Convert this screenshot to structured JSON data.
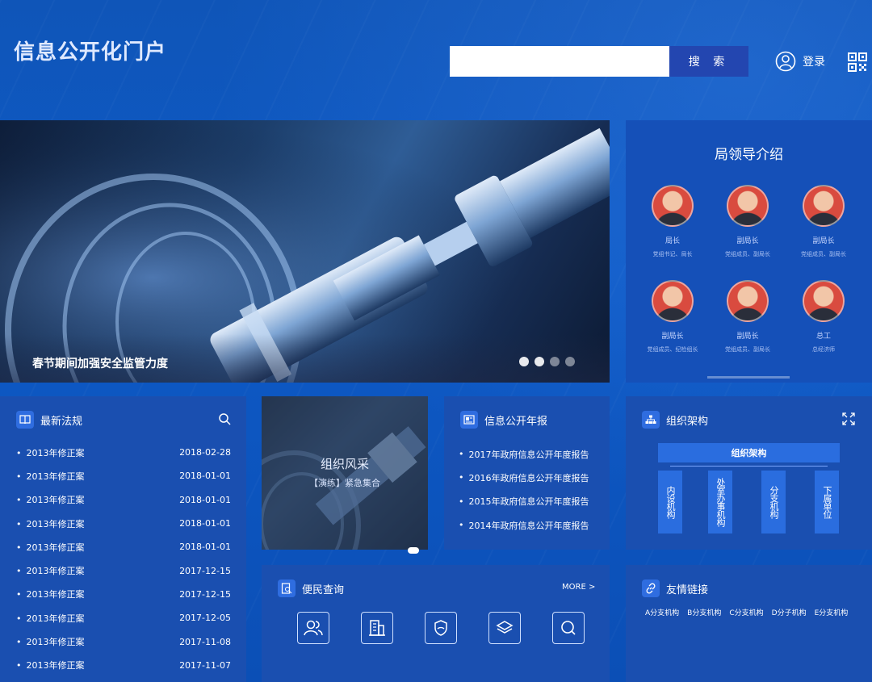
{
  "header": {
    "site_title": "信息公开化门户",
    "search_placeholder": "",
    "search_button": "搜 索",
    "login_label": "登录"
  },
  "banner": {
    "caption": "春节期间加强安全监管力度",
    "slide_count": 4,
    "active_slide": 1
  },
  "leaders": {
    "title": "局领导介绍",
    "items": [
      {
        "name": "局长",
        "role": "党组书记、局长"
      },
      {
        "name": "副局长",
        "role": "党组成员、副局长"
      },
      {
        "name": "副局长",
        "role": "党组成员、副局长"
      },
      {
        "name": "副局长",
        "role": "党组成员、纪检组长"
      },
      {
        "name": "副局长",
        "role": "党组成员、副局长"
      },
      {
        "name": "总工",
        "role": "总经济师"
      }
    ]
  },
  "regulations": {
    "title": "最新法规",
    "items": [
      {
        "title": "2013年修正案",
        "date": "2018-02-28"
      },
      {
        "title": "2013年修正案",
        "date": "2018-01-01"
      },
      {
        "title": "2013年修正案",
        "date": "2018-01-01"
      },
      {
        "title": "2013年修正案",
        "date": "2018-01-01"
      },
      {
        "title": "2013年修正案",
        "date": "2018-01-01"
      },
      {
        "title": "2013年修正案",
        "date": "2017-12-15"
      },
      {
        "title": "2013年修正案",
        "date": "2017-12-15"
      },
      {
        "title": "2013年修正案",
        "date": "2017-12-05"
      },
      {
        "title": "2013年修正案",
        "date": "2017-11-08"
      },
      {
        "title": "2013年修正案",
        "date": "2017-11-07"
      }
    ]
  },
  "org_style": {
    "title": "组织风采",
    "subtitle": "【演练】紧急集合"
  },
  "reports": {
    "title": "信息公开年报",
    "items": [
      "2017年政府信息公开年度报告",
      "2016年政府信息公开年度报告",
      "2015年政府信息公开年度报告",
      "2014年政府信息公开年度报告"
    ]
  },
  "org_structure": {
    "title": "组织架构",
    "root": "组织架构",
    "children": [
      "内设机构",
      "处室办事机构",
      "分支机构",
      "下属单位"
    ]
  },
  "query": {
    "title": "便民查询",
    "more": "MORE >",
    "icons": [
      "users-icon",
      "building-icon",
      "shield-icon",
      "layers-icon",
      "search-icon"
    ]
  },
  "links": {
    "title": "友情链接",
    "items": [
      "A分支机构",
      "B分支机构",
      "C分支机构",
      "D分子机构",
      "E分支机构"
    ]
  },
  "colors": {
    "background": "#0e5ac6",
    "panel": "#1a4fb0",
    "accent": "#2a6ddf",
    "search_button": "#2346b0"
  }
}
